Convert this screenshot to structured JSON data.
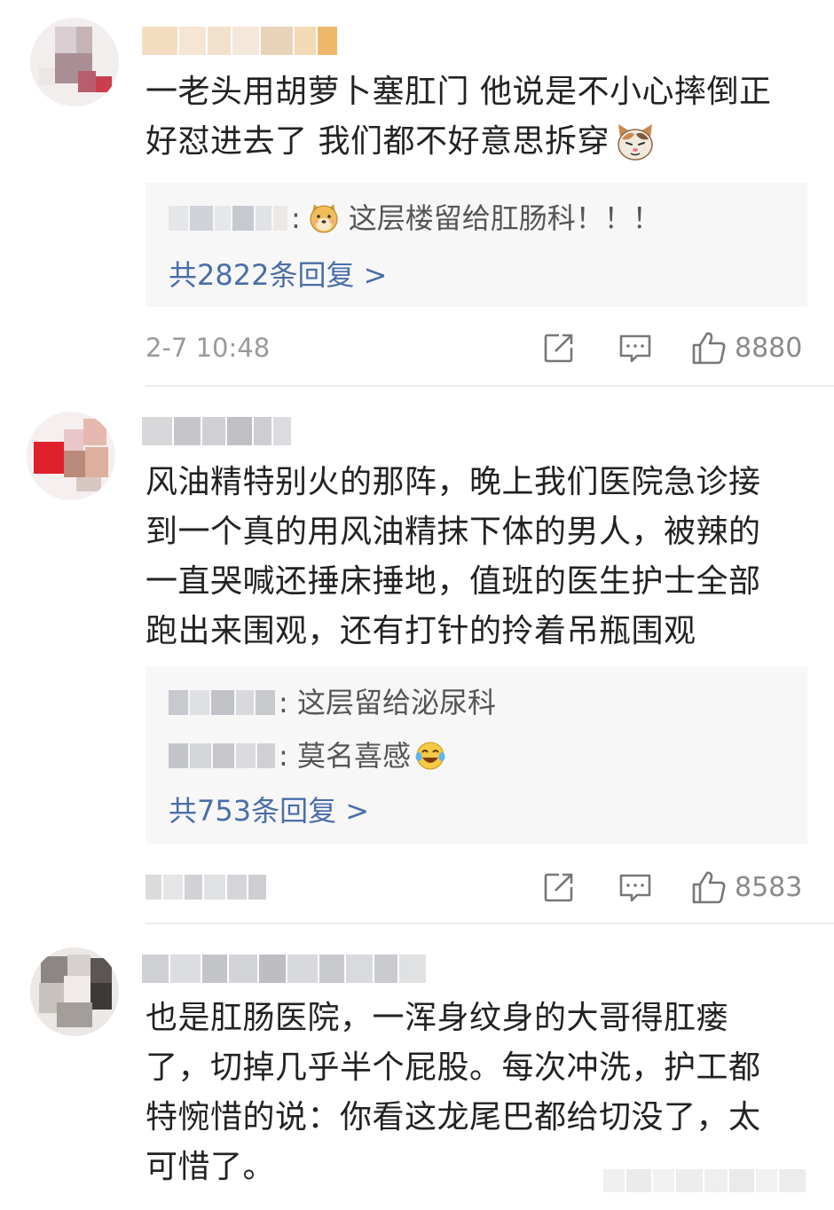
{
  "comments": [
    {
      "text_lines": [
        "一老头用胡萝卜塞肛门 他说是不小心摔倒正",
        "好怼进去了 我们都不好意思拆穿"
      ],
      "emoji": "cat-face-emoji",
      "replies": [
        {
          "text": "这层楼留给肛肠科！！！",
          "emoji": "dog-face-emoji"
        }
      ],
      "more_replies": "共2822条回复 >",
      "timestamp": "2-7 10:48",
      "likes": "8880"
    },
    {
      "text_lines": [
        "风油精特别火的那阵，晚上我们医院急诊接",
        "到一个真的用风油精抹下体的男人，被辣的",
        "一直哭喊还捶床捶地，值班的医生护士全部",
        "跑出来围观，还有打针的拎着吊瓶围观"
      ],
      "replies": [
        {
          "text": ": 这层留给泌尿科"
        },
        {
          "text": ": 莫名喜感",
          "emoji": "laughing-crying-emoji"
        }
      ],
      "more_replies": "共753条回复 >",
      "timestamp": "",
      "likes": "8583"
    },
    {
      "text_lines": [
        "也是肛肠医院，一浑身纹身的大哥得肛瘘",
        "了，切掉几乎半个屁股。每次冲洗，护工都",
        "特惋惜的说：你看这龙尾巴都给切没了，太",
        "可惜了。"
      ]
    }
  ],
  "colors": {
    "link": "#4a6ea8",
    "meta": "#9a9a9a",
    "reply_bg": "#f7f7f7"
  },
  "icons": [
    "share-icon",
    "comment-icon",
    "like-icon"
  ]
}
